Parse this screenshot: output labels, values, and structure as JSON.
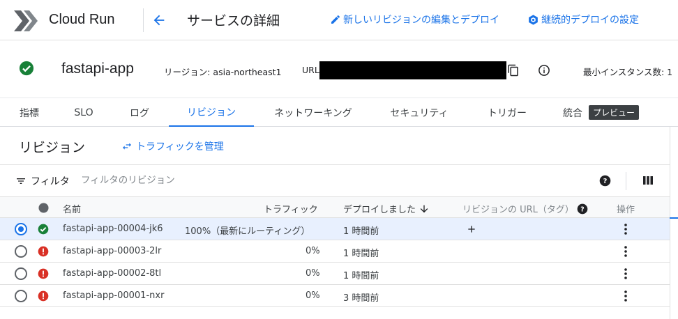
{
  "app": {
    "name": "Cloud Run"
  },
  "header": {
    "title": "サービスの詳細",
    "actions": [
      {
        "label": "新しいリビジョンの編集とデプロイ",
        "icon": "edit-icon"
      },
      {
        "label": "継続的デプロイの設定",
        "icon": "build-icon"
      }
    ]
  },
  "service": {
    "name": "fastapi-app",
    "status": "ok",
    "region_label": "リージョン: asia-northeast1",
    "url_label": "URL:",
    "min_instances_label": "最小インスタンス数: 1"
  },
  "tabs": [
    {
      "label": "指標",
      "active": false
    },
    {
      "label": "SLO",
      "active": false
    },
    {
      "label": "ログ",
      "active": false
    },
    {
      "label": "リビジョン",
      "active": true
    },
    {
      "label": "ネットワーキング",
      "active": false
    },
    {
      "label": "セキュリティ",
      "active": false
    },
    {
      "label": "トリガー",
      "active": false
    },
    {
      "label": "統合",
      "active": false
    }
  ],
  "tabs_badge": "プレビュー",
  "section": {
    "title": "リビジョン",
    "traffic_link": "トラフィックを管理"
  },
  "filter": {
    "label": "フィルタ",
    "placeholder": "フィルタのリビジョン"
  },
  "table": {
    "columns": {
      "name": "名前",
      "traffic": "トラフィック",
      "deployed": "デプロイしました",
      "url": "リビジョンの URL（タグ）",
      "actions": "操作"
    },
    "rows": [
      {
        "name": "fastapi-app-00004-jk6",
        "traffic": "100%（最新にルーティング）",
        "deployed": "1 時間前",
        "status": "ok",
        "selected": true
      },
      {
        "name": "fastapi-app-00003-2lr",
        "traffic": "0%",
        "deployed": "1 時間前",
        "status": "error",
        "selected": false
      },
      {
        "name": "fastapi-app-00002-8tl",
        "traffic": "0%",
        "deployed": "1 時間前",
        "status": "error",
        "selected": false
      },
      {
        "name": "fastapi-app-00001-nxr",
        "traffic": "0%",
        "deployed": "3 時間前",
        "status": "error",
        "selected": false
      }
    ]
  },
  "colors": {
    "accent": "#1a73e8",
    "ok": "#188038",
    "error": "#d93025",
    "badge": "#3c4043"
  }
}
